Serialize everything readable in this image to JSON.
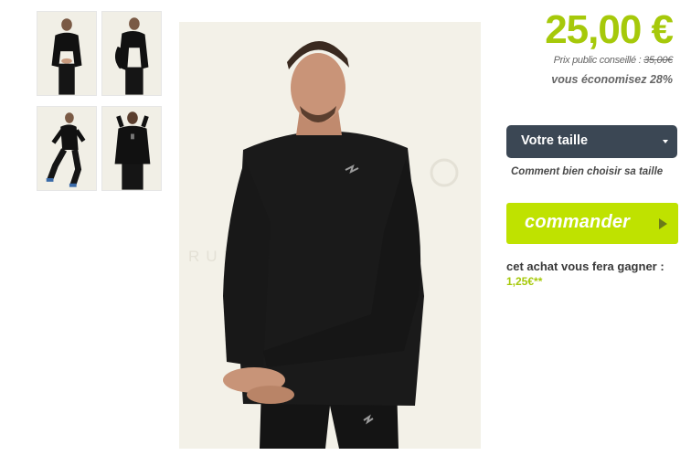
{
  "gallery": {
    "thumbnails": [
      {
        "icon": "product-photo-front"
      },
      {
        "icon": "product-photo-side"
      },
      {
        "icon": "product-photo-running"
      },
      {
        "icon": "product-photo-back"
      }
    ],
    "main_image": {
      "watermark": "RUNNING FITNESS"
    }
  },
  "product": {
    "price": "25,00 €",
    "msrp_label": "Prix public conseillé : ",
    "msrp_value": "35,00€",
    "savings": "vous économisez 28%"
  },
  "size": {
    "selected": "Votre taille",
    "help_link": "Comment bien choisir sa taille"
  },
  "order": {
    "button_label": "commander"
  },
  "rewards": {
    "text": "cet achat vous fera gagner :",
    "amount": "1,25€**"
  },
  "colors": {
    "accent": "#a6c90a",
    "button": "#bfe200",
    "select_bg": "#3b4754"
  }
}
